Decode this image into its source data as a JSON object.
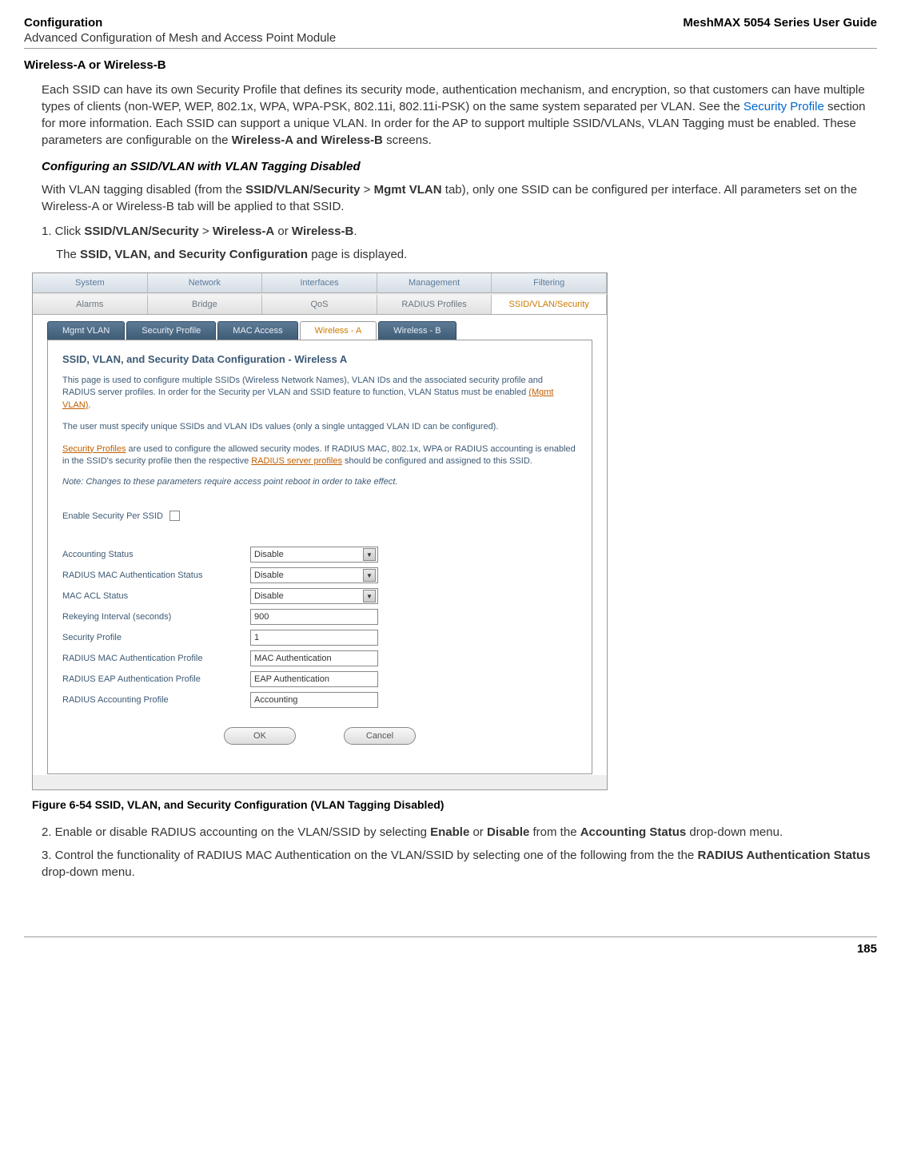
{
  "header": {
    "left": "Configuration",
    "right": "MeshMAX 5054 Series User Guide",
    "sub": "Advanced Configuration of Mesh and Access Point Module"
  },
  "section_title": "Wireless-A or Wireless-B",
  "para1_part1": "Each SSID can have its own Security Profile that defines its security mode, authentication mechanism, and encryption, so that customers can have multiple types of clients (non-WEP, WEP, 802.1x, WPA, WPA-PSK, 802.11i, 802.11i-PSK) on the same system separated per VLAN. See the ",
  "para1_link": "Security Profile",
  "para1_part2": " section for more information. Each SSID can support a unique VLAN. In order for the AP to support multiple SSID/VLANs, VLAN Tagging must be enabled. These parameters are configurable on the ",
  "para1_bold": "Wireless-A and Wireless-B",
  "para1_part3": " screens.",
  "sub_heading": "Configuring an SSID/VLAN with VLAN Tagging Disabled",
  "para2_part1": "With VLAN tagging disabled (from the ",
  "para2_bold1": "SSID/VLAN/Security",
  "para2_mid": " > ",
  "para2_bold2": "Mgmt VLAN",
  "para2_part2": " tab), only one SSID can be configured per interface. All parameters set on the Wireless-A or Wireless-B tab will be applied to that SSID.",
  "step1_num": "1.  Click ",
  "step1_b1": "SSID/VLAN/Security",
  "step1_mid1": " > ",
  "step1_b2": "Wireless-A",
  "step1_mid2": " or ",
  "step1_b3": "Wireless-B",
  "step1_end": ".",
  "step1_result": "The ",
  "step1_result_bold": "SSID, VLAN, and Security Configuration",
  "step1_result_end": " page is displayed.",
  "tabs1": [
    "System",
    "Network",
    "Interfaces",
    "Management",
    "Filtering"
  ],
  "tabs2": [
    "Alarms",
    "Bridge",
    "QoS",
    "RADIUS Profiles",
    "SSID/VLAN/Security"
  ],
  "subtabs": [
    "Mgmt VLAN",
    "Security Profile",
    "MAC Access",
    "Wireless - A",
    "Wireless - B"
  ],
  "panel": {
    "title": "SSID, VLAN, and Security Data Configuration - Wireless A",
    "text1": "This page is used to configure multiple SSIDs (Wireless Network Names), VLAN IDs and the associated security profile and RADIUS server profiles. In order for the Security per VLAN and SSID feature to function, VLAN Status must be enabled ",
    "text1_link": "(Mgmt VLAN)",
    "text1_end": ".",
    "text2": "The user must specify unique SSIDs and VLAN IDs values (only a single untagged VLAN ID can be configured).",
    "text3_link1": "Security Profiles",
    "text3_mid": " are used to configure the allowed security modes. If RADIUS MAC, 802.1x, WPA or RADIUS accounting is enabled in the SSID's security profile then the respective ",
    "text3_link2": "RADIUS server profiles",
    "text3_end": " should be configured and assigned to this SSID.",
    "note": "Note: Changes to these parameters require access point reboot in order to take effect.",
    "chk_label": "Enable Security Per SSID"
  },
  "form": {
    "accounting_status": {
      "label": "Accounting Status",
      "value": "Disable"
    },
    "radius_mac_auth_status": {
      "label": "RADIUS MAC Authentication Status",
      "value": "Disable"
    },
    "mac_acl_status": {
      "label": "MAC ACL Status",
      "value": "Disable"
    },
    "rekeying": {
      "label": "Rekeying Interval (seconds)",
      "value": "900"
    },
    "sec_profile": {
      "label": "Security Profile",
      "value": "1"
    },
    "radius_mac_profile": {
      "label": "RADIUS MAC Authentication Profile",
      "value": "MAC Authentication"
    },
    "radius_eap_profile": {
      "label": "RADIUS EAP Authentication Profile",
      "value": "EAP Authentication"
    },
    "radius_acct_profile": {
      "label": "RADIUS Accounting Profile",
      "value": "Accounting"
    }
  },
  "buttons": {
    "ok": "OK",
    "cancel": "Cancel"
  },
  "figure_caption": "Figure 6-54 SSID, VLAN, and Security Configuration (VLAN Tagging Disabled)",
  "step2_num": "2.  Enable or disable RADIUS accounting on the VLAN/SSID by selecting ",
  "step2_b1": "Enable",
  "step2_mid1": " or ",
  "step2_b2": "Disable",
  "step2_mid2": " from the ",
  "step2_b3": "Accounting Status",
  "step2_end": " drop-down menu.",
  "step3_num": "3.  Control the functionality of RADIUS MAC Authentication on the VLAN/SSID by selecting one of the following from the the ",
  "step3_b1": "RADIUS Authentication Status",
  "step3_end": " drop-down menu.",
  "page_number": "185"
}
